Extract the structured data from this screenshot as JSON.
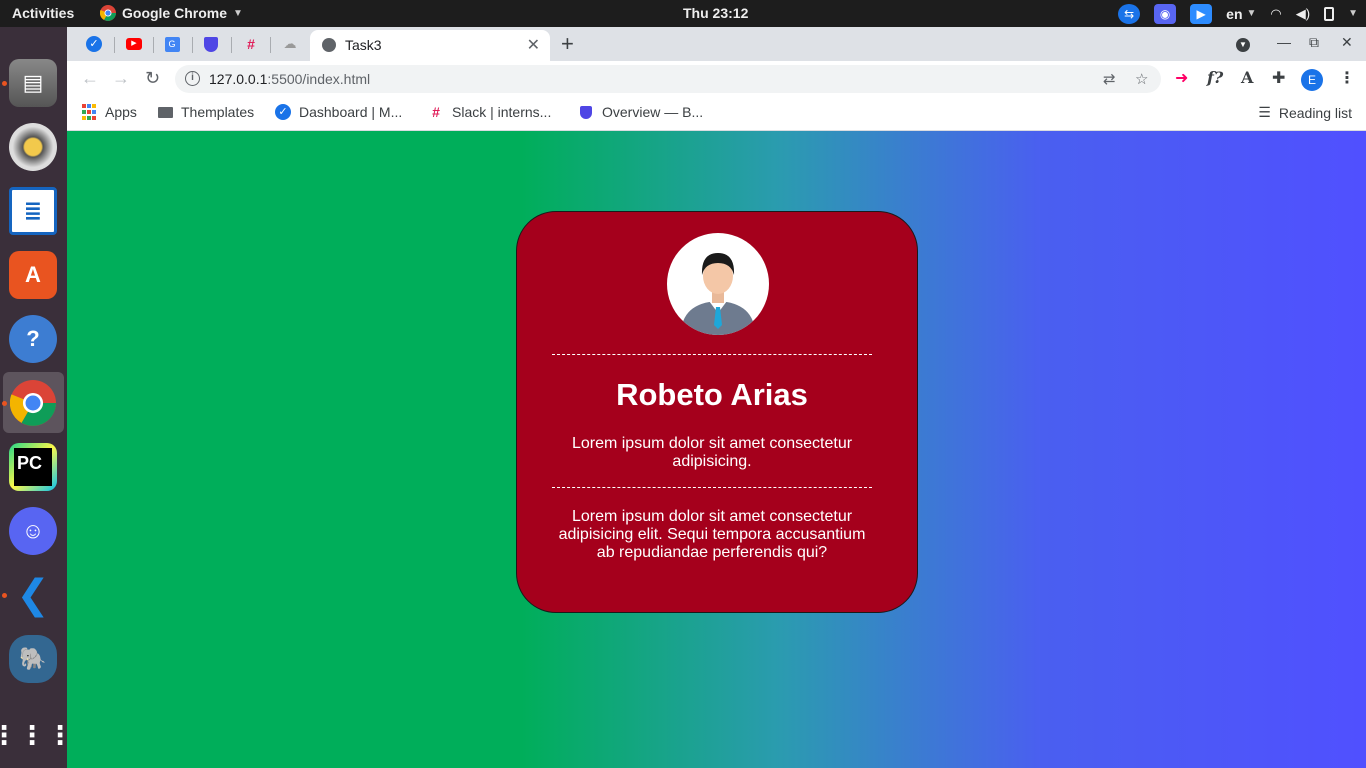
{
  "os": {
    "activities_label": "Activities",
    "app_name": "Google Chrome",
    "clock": "Thu 23:12",
    "language": "en"
  },
  "browser": {
    "active_tab_title": "Task3",
    "url_host": "127.0.0.1",
    "url_rest": ":5500/index.html",
    "profile_initial": "E",
    "bookmarks": [
      {
        "label": "Apps"
      },
      {
        "label": "Themplates"
      },
      {
        "label": "Dashboard | M..."
      },
      {
        "label": "Slack | interns..."
      },
      {
        "label": "Overview — B..."
      }
    ],
    "reading_list_label": "Reading list",
    "extensions": {
      "formula": "f?",
      "font": "A"
    }
  },
  "page": {
    "background_colors": {
      "left": "#00ae5a",
      "right": "#5050ff"
    },
    "card": {
      "background": "#a5001c",
      "name": "Robeto Arias",
      "description": "Lorem ipsum dolor sit amet consectetur adipisicing.",
      "bio": "Lorem ipsum dolor sit amet consectetur adipisicing elit. Sequi tempora accusantium ab repudiandae perferendis qui?"
    }
  }
}
